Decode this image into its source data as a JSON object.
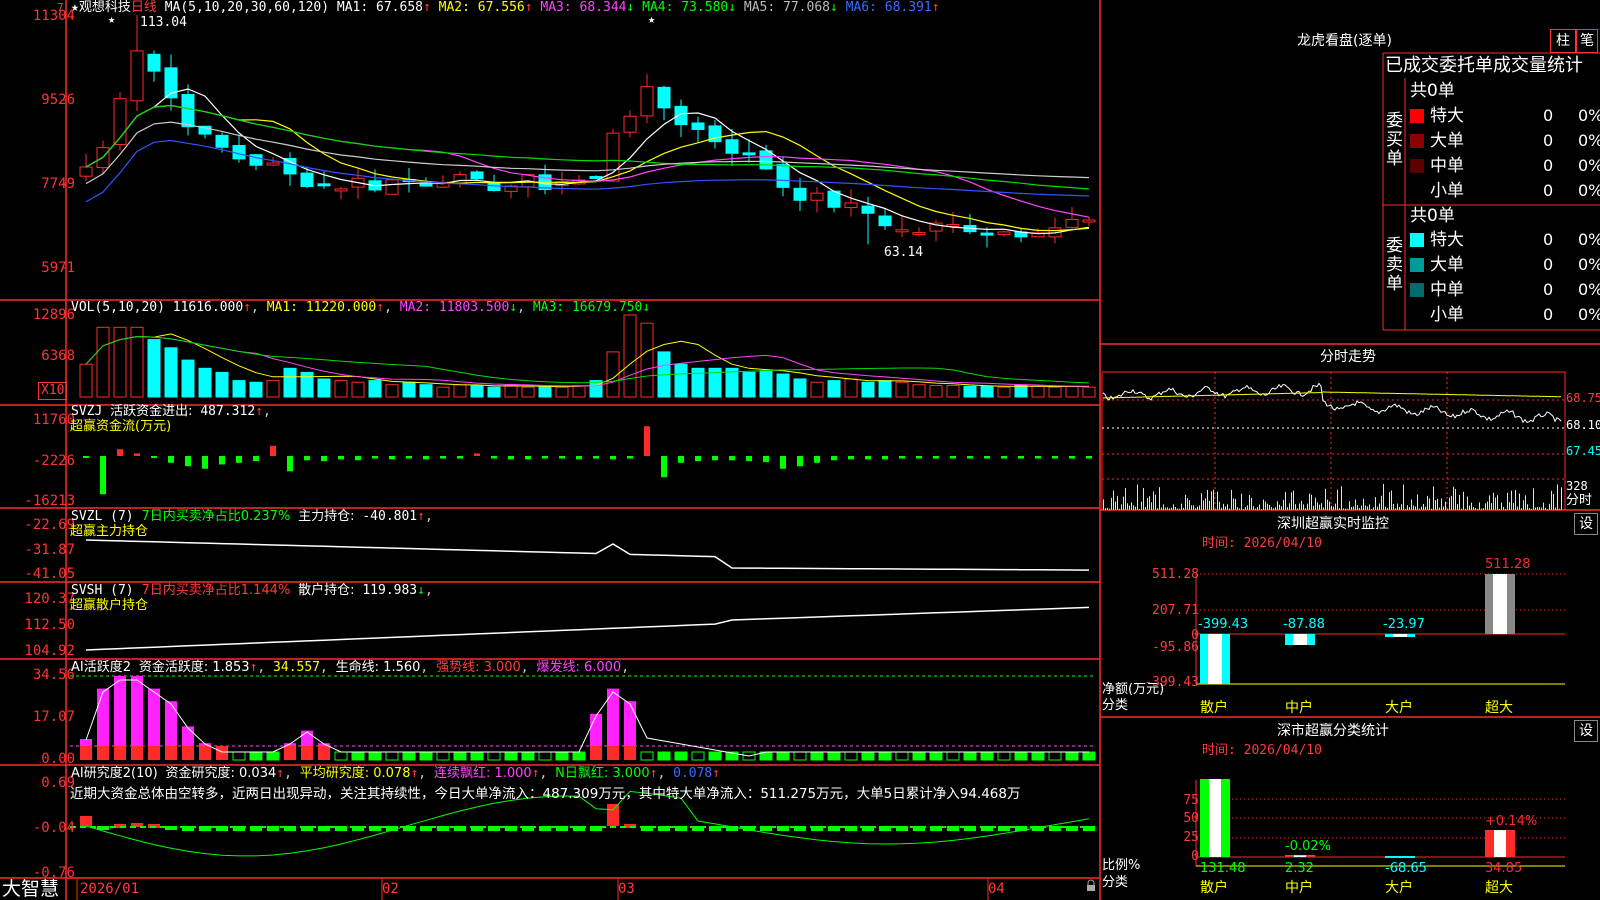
{
  "app": {
    "brand": "大智慧",
    "stock_name": "观想科技",
    "period": "日线"
  },
  "price_panel": {
    "star": "★",
    "ma_params": "MA(5,10,20,30,60,120)",
    "ma1_label": "MA1: 67.658",
    "ma1_arrow": "↑",
    "ma2_label": "MA2: 67.556",
    "ma2_arrow": "↑",
    "ma3_label": "MA3: 68.344",
    "ma3_arrow": "↓",
    "ma4_label": "MA4: 73.580",
    "ma4_arrow": "↓",
    "ma5_label": "MA5: 77.068",
    "ma5_arrow": "↓",
    "ma6_label": "MA6: 68.391",
    "ma6_arrow": "↑",
    "high_label": "113.04",
    "low_label": "63.14",
    "axis": [
      "11304",
      "9526",
      "7749",
      "5971"
    ],
    "marker": "7"
  },
  "vol_panel": {
    "title": "VOL(5,10,20)",
    "value": "11616.000",
    "value_arrow": "↑",
    "ma1": "MA1: 11220.000",
    "ma1_arrow": "↑",
    "ma2": "MA2: 11803.500",
    "ma2_arrow": "↓",
    "ma3": "MA3: 16679.750",
    "ma3_arrow": "↓",
    "axis": [
      "12896",
      "6368"
    ],
    "unit": "X10"
  },
  "svzj_panel": {
    "title": "SVZJ",
    "label": "活跃资金进出:",
    "value": "487.312",
    "arrow": "↑",
    "subtitle": "超赢资金流(万元)",
    "axis": [
      "11760",
      "-2226",
      "-16213"
    ]
  },
  "svzl_panel": {
    "title": "SVZL (7)",
    "ratio": "7日内买卖净占比0.237%",
    "label": "主力持仓:",
    "value": "-40.801",
    "arrow": "↑",
    "subtitle": "超赢主力持仓",
    "axis": [
      "-22.69",
      "-31.87",
      "-41.05"
    ]
  },
  "svsh_panel": {
    "title": "SVSH (7)",
    "ratio": "7日内买卖净占比1.144%",
    "label": "散户持仓:",
    "value": "119.983",
    "arrow": "↓",
    "subtitle": "超赢散户持仓",
    "axis": [
      "120.37",
      "112.50",
      "104.92"
    ]
  },
  "ai_activity": {
    "title": "AI活跃度2",
    "label1": "资金活跃度: 1.853",
    "arrow1": "↑",
    "val2": "34.557",
    "label3": "生命线: 1.560",
    "label4": "强势线: 3.000",
    "label5": "爆发线: 6.000",
    "axis": [
      "34.56",
      "17.07",
      "0.00"
    ]
  },
  "ai_research": {
    "title": "AI研究度2(10)",
    "label1": "资金研究度: 0.034",
    "arrow1": "↑",
    "label2": "平均研究度: 0.078",
    "arrow2": "↑",
    "label3": "连续飘红: 1.000",
    "arrow3": "↑",
    "label4": "N日飘红: 3.000",
    "arrow4": "↑",
    "label5": "0.078",
    "arrow5": "↑",
    "comment": "近期大资金总体由空转多，近两日出现异动，关注其持续性，今日大单净流入：487.309万元，其中特大单净流入：511.275万元，大单5日累计净入94.468万",
    "axis": [
      "0.69",
      "-0.04",
      "-0.76"
    ]
  },
  "dates": [
    "2026/01",
    "02",
    "03",
    "04"
  ],
  "dragon": {
    "title": "龙虎看盘(逐单)",
    "btn_zhu": "柱",
    "btn_bi": "笔",
    "section_title": "已成交委托单成交量统计",
    "buy_label": [
      "委",
      "买",
      "单"
    ],
    "sell_label": [
      "委",
      "卖",
      "单"
    ],
    "buy_total": "共0单",
    "sell_total": "共0单",
    "buy_rows": [
      {
        "name": "特大",
        "count": "0",
        "pct": "0%",
        "color": "#ff0000"
      },
      {
        "name": "大单",
        "count": "0",
        "pct": "0%",
        "color": "#8b0000"
      },
      {
        "name": "中单",
        "count": "0",
        "pct": "0%",
        "color": "#5a0000"
      },
      {
        "name": "小单",
        "count": "0",
        "pct": "0%",
        "color": "#000000"
      }
    ],
    "sell_rows": [
      {
        "name": "特大",
        "count": "0",
        "pct": "0%",
        "color": "#00ffff"
      },
      {
        "name": "大单",
        "count": "0",
        "pct": "0%",
        "color": "#009a9a"
      },
      {
        "name": "中单",
        "count": "0",
        "pct": "0%",
        "color": "#006b6b"
      },
      {
        "name": "小单",
        "count": "0",
        "pct": "0%",
        "color": "#000000"
      }
    ]
  },
  "intraday": {
    "title": "分时走势",
    "axis": [
      "68.75",
      "68.10",
      "67.45"
    ],
    "vol_value": "328",
    "vol_label": "分时"
  },
  "monitor": {
    "title": "深圳超赢实时监控",
    "settings": "设",
    "time": "时间: 2026/04/10",
    "axis": [
      "511.28",
      "207.71",
      "0",
      "-95.86",
      "-399.43"
    ],
    "ylabel": "净额(万元)",
    "xlabel": "分类",
    "chart_data": {
      "type": "bar",
      "title": "深圳超赢实时监控",
      "categories": [
        "散户",
        "中户",
        "大户",
        "超大"
      ],
      "values": [
        -399.43,
        -87.88,
        -23.97,
        511.28
      ],
      "ylabel": "净额(万元)",
      "xlabel": "分类",
      "ylim": [
        -399.43,
        511.28
      ]
    }
  },
  "classify": {
    "title": "深市超赢分类统计",
    "settings": "设",
    "time": "时间: 2026/04/10",
    "axis": [
      "75",
      "50",
      "25",
      "0"
    ],
    "ylabel": "比例%",
    "xlabel": "分类",
    "bar_labels": [
      "",
      "-0.02%",
      "",
      "+0.14%"
    ],
    "chart_data": {
      "type": "bar",
      "title": "深市超赢分类统计",
      "categories": [
        "散户",
        "中户",
        "大户",
        "超大"
      ],
      "values": [
        131.48,
        2.32,
        -68.65,
        34.85
      ],
      "ylabel": "比例%",
      "xlabel": "分类",
      "ylim": [
        0,
        75
      ]
    }
  }
}
